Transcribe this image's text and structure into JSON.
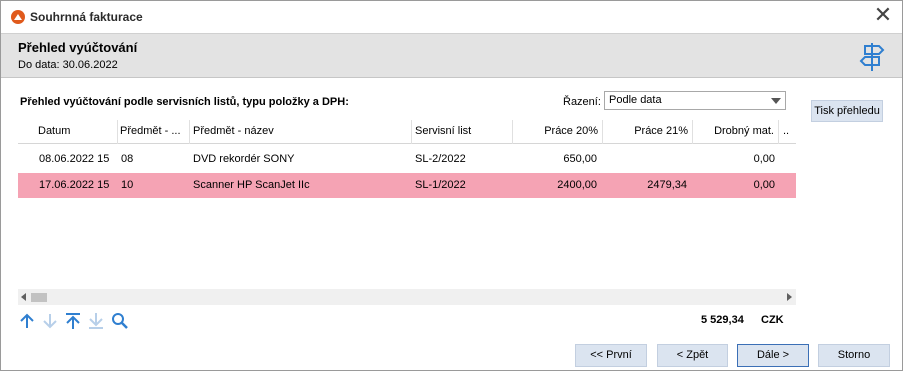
{
  "window": {
    "title": "Souhrnná fakturace",
    "close_label": "✕"
  },
  "header": {
    "title": "Přehled vyúčtování",
    "subtitle": "Do data: 30.06.2022"
  },
  "section": {
    "label": "Přehled vyúčtování podle servisních listů, typu položky a DPH:"
  },
  "sort": {
    "label": "Řazení:",
    "selected": "Podle data"
  },
  "print_button": "Tisk přehledu",
  "table": {
    "columns": [
      "Datum",
      "Předmět - ...",
      "Předmět - název",
      "Servisní list",
      "Práce 20%",
      "Práce 21%",
      "Drobný mat.",
      ".."
    ],
    "rows": [
      {
        "datum": "08.06.2022 15",
        "predmet_kod": "08",
        "predmet_nazev": "DVD rekordér SONY",
        "servisni_list": "SL-2/2022",
        "prace20": "650,00",
        "prace21": "",
        "drobny_mat": "0,00",
        "selected": false
      },
      {
        "datum": "17.06.2022 15",
        "predmet_kod": "10",
        "predmet_nazev": "Scanner HP ScanJet IIc",
        "servisni_list": "SL-1/2022",
        "prace20": "2400,00",
        "prace21": "2479,34",
        "drobny_mat": "0,00",
        "selected": true
      }
    ]
  },
  "nav_icons": [
    "arrow-up-icon",
    "arrow-down-icon",
    "arrow-top-icon",
    "arrow-bottom-icon",
    "search-icon"
  ],
  "total": {
    "value": "5 529,34",
    "currency": "CZK"
  },
  "buttons": {
    "first": "<< První",
    "back": "< Zpět",
    "next": "Dále >",
    "cancel": "Storno"
  },
  "colors": {
    "selected_row": "#f5a3b4",
    "accent": "#2f7fd0",
    "button_bg": "#dbe4f0",
    "logo": "#e05a1c"
  }
}
